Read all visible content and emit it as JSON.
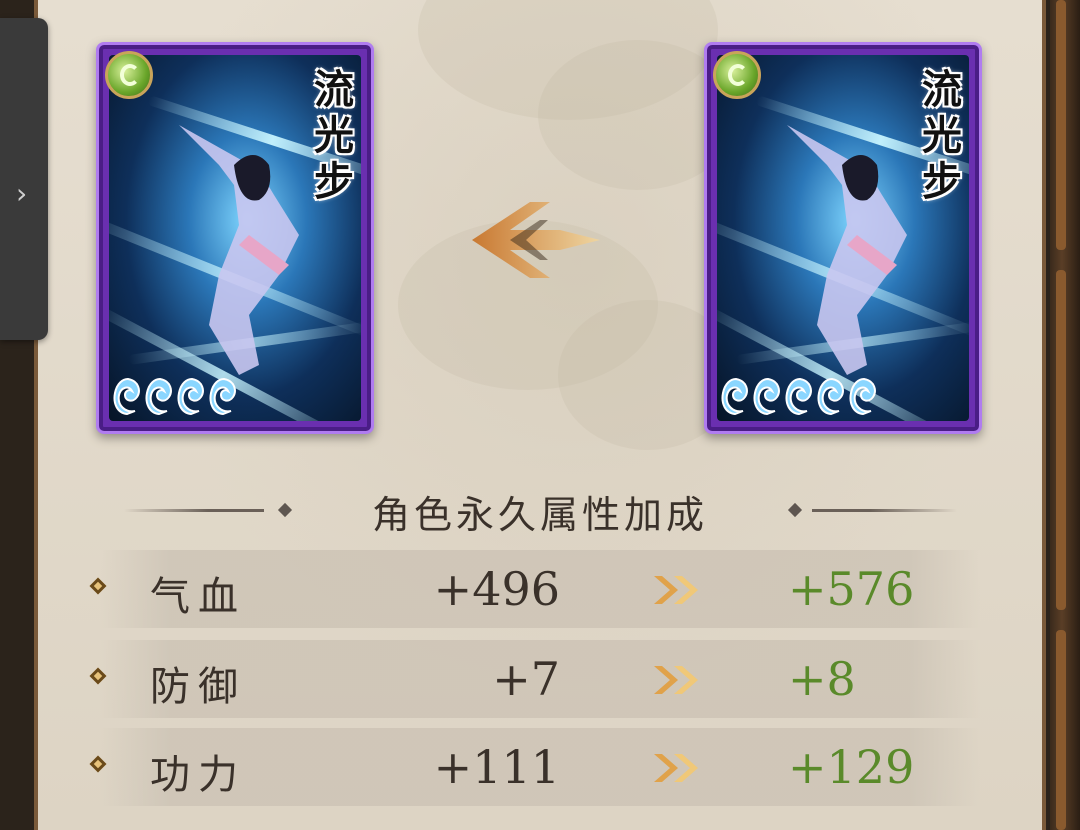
{
  "left_card": {
    "name_chars": [
      "流",
      "光",
      "步"
    ],
    "level_drops": 4,
    "badge_icon": "green-swirl-element-icon"
  },
  "right_card": {
    "name_chars": [
      "流",
      "光",
      "步"
    ],
    "level_drops": 5,
    "badge_icon": "green-swirl-element-icon"
  },
  "section_title": "角色永久属性加成",
  "stats": [
    {
      "name": "气血",
      "old": "+496",
      "new": "+576"
    },
    {
      "name": "防御",
      "old": "+7",
      "new": "+8"
    },
    {
      "name": "功力",
      "old": "+111",
      "new": "+129"
    }
  ],
  "colors": {
    "card_border": "#6a2fb0",
    "new_value": "#5a8a2a",
    "arrow": "#e0a24a"
  }
}
